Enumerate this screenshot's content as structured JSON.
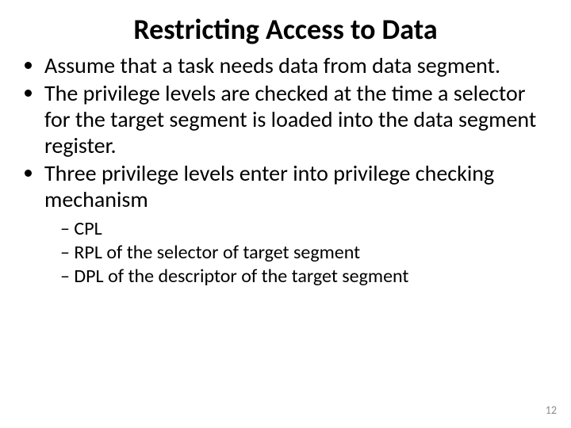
{
  "slide": {
    "title": "Restricting Access to Data",
    "bullets": [
      "Assume that a task needs data from data segment.",
      "The privilege levels are checked at the time a selector for the target segment is loaded into the data segment register.",
      "Three privilege levels enter into privilege checking mechanism"
    ],
    "subbullets": [
      "CPL",
      "RPL of the selector of target segment",
      "DPL of the descriptor of the target segment"
    ],
    "page_number": "12"
  }
}
